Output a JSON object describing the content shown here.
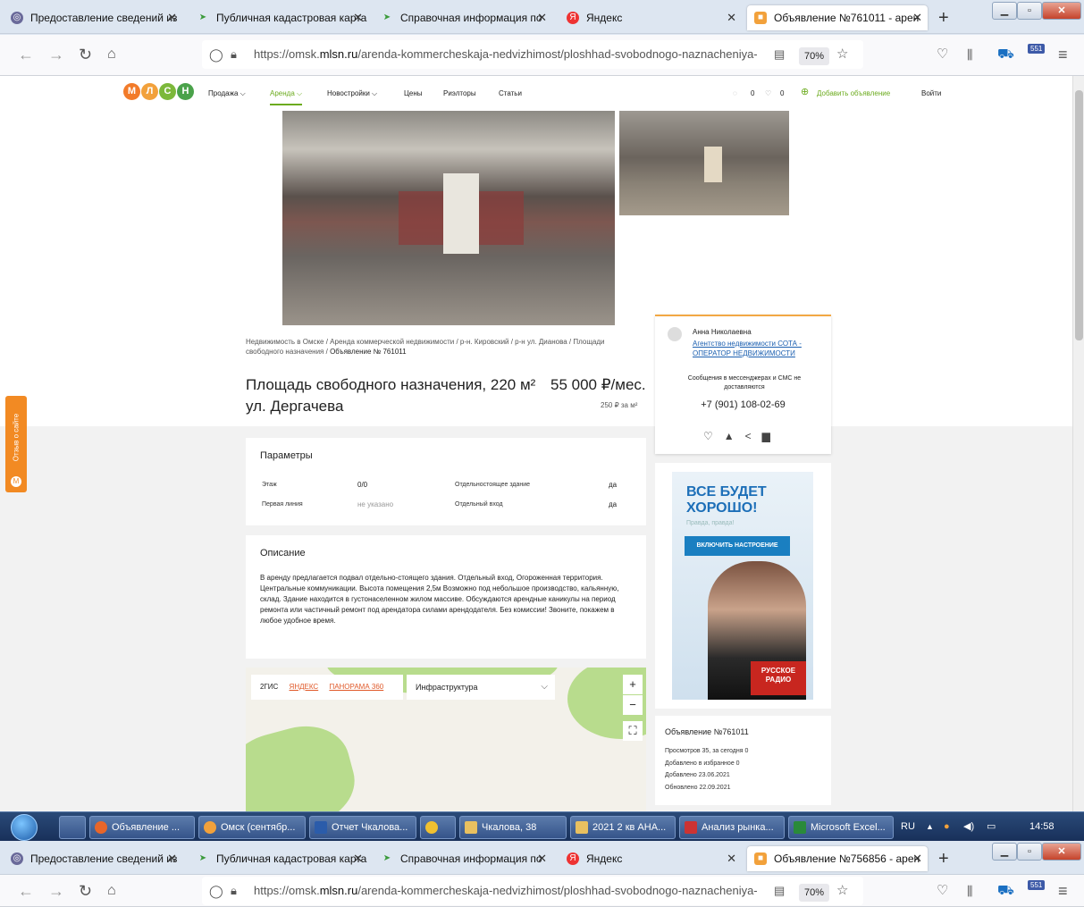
{
  "browser1": {
    "tabs": [
      {
        "label": "Предоставление сведений из",
        "icon": "circle-icon",
        "color": "#6a6a9a"
      },
      {
        "label": "Публичная кадастровая карта",
        "icon": "arrow-icon",
        "color": "#3a9a3a"
      },
      {
        "label": "Справочная информация по",
        "icon": "arrow-icon",
        "color": "#3a9a3a"
      },
      {
        "label": "Яндекс",
        "icon": "yandex-icon",
        "color": "#e33"
      },
      {
        "label": "Объявление №761011 - арен",
        "icon": "mlsn-icon",
        "color": "#f2a13b"
      }
    ],
    "url_prefix": "https://omsk.",
    "url_domain": "mlsn.ru",
    "url_path": "/arenda-kommercheskaja-nedvizhimost/ploshhad-svobodnogo-naznacheniya-",
    "zoom": "70%",
    "badge": "551"
  },
  "site": {
    "logo_letters": [
      "М",
      "Л",
      "С",
      "Н"
    ],
    "menu": [
      "Продажа ⌵",
      "Аренда ⌵",
      "Новостройки ⌵",
      "Цены",
      "Риэлторы",
      "Статьи"
    ],
    "compare_count": "0",
    "fav_count": "0",
    "add_ad": "Добавить объявление",
    "login": "Войти"
  },
  "listing": {
    "breadcrumbs": "Недвижимость в Омске / Аренда коммерческой недвижимости / р-н. Кировский / р-н ул. Дианова / Площади свободного назначения / ",
    "breadcrumb_current": "Объявление № 761011",
    "title_line1": "Площадь свободного назначения, 220 м²",
    "title_line2": "ул. Дергачева",
    "price": "55 000 ₽/мес.",
    "price_per_m2": "250 ₽ за м²"
  },
  "agent": {
    "name": "Анна Николаевна",
    "agency": "Агентство недвижимости СОТА - ОПЕРАТОР НЕДВИЖИМОСТИ",
    "note": "Сообщения в мессенджерах и СМС не доставляются",
    "phone": "+7 (901) 108-02-69"
  },
  "params": {
    "title": "Параметры",
    "rows": [
      {
        "label": "Этаж",
        "value": "0/0"
      },
      {
        "label": "Первая линия",
        "value": "не указано"
      },
      {
        "label": "Отдельностоящее здание",
        "value": "да"
      },
      {
        "label": "Отдельный вход",
        "value": "да"
      }
    ]
  },
  "description": {
    "title": "Описание",
    "text": "В аренду предлагается подвал отдельно-стоящего здания. Отдельный вход, Огороженная территория. Центральные коммуникации. Высота помещения 2,5м Возможно под небольшое производство, кальянную, склад. Здание находится в густонаселенном жилом массиве. Обсуждаются арендные каникулы на период ремонта или частичный ремонт под арендатора силами арендодателя. Без комиссии! Звоните, покажем в любое удобное время."
  },
  "map": {
    "tabs": [
      "2ГИС",
      "ЯНДЕКС",
      "ПАНОРАМА 360"
    ],
    "select": "Инфраструктура",
    "zoom_in": "+",
    "zoom_out": "−"
  },
  "ad": {
    "headline": "ВСЕ БУДЕТ ХОРОШО!",
    "sub": "Правда, правда!",
    "button": "ВКЛЮЧИТЬ НАСТРОЕНИЕ",
    "brand": "РУССКОЕ РАДИО"
  },
  "stats": {
    "title": "Объявление №761011",
    "views": "Просмотров 35, за сегодня 0",
    "favs": "Добавлено в избранное 0",
    "added": "Добавлено 23.06.2021",
    "updated": "Обновлено 22.09.2021"
  },
  "feedback": "Отзыв о сайте",
  "taskbar": {
    "items": [
      "Объявление ...",
      "Омск (сентябр...",
      "Отчет Чкалова...",
      "",
      "Чкалова, 38",
      "2021 2 кв АНА...",
      "Анализ рынка...",
      "Microsoft Excel..."
    ],
    "lang": "RU",
    "time": "14:58"
  },
  "browser2": {
    "tabs": [
      {
        "label": "Предоставление сведений из"
      },
      {
        "label": "Публичная кадастровая карта"
      },
      {
        "label": "Справочная информация по"
      },
      {
        "label": "Яндекс"
      },
      {
        "label": "Объявление №756856 - арен"
      }
    ],
    "url_prefix": "https://omsk.",
    "url_domain": "mlsn.ru",
    "url_path": "/arenda-kommercheskaja-nedvizhimost/ploshhad-svobodnogo-naznacheniya-",
    "zoom": "70%",
    "badge": "551"
  }
}
